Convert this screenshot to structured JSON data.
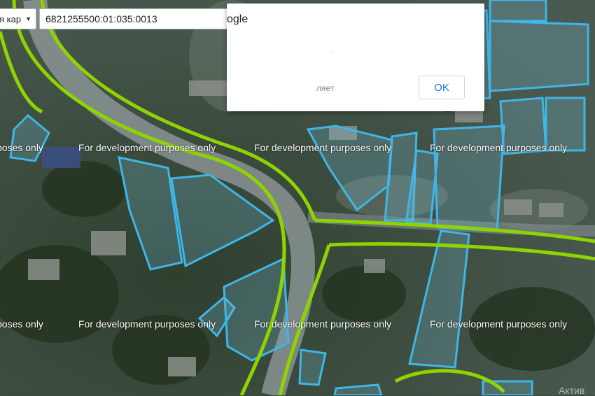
{
  "map_layer_select": {
    "label": "я кар",
    "caret": "▼"
  },
  "search": {
    "value": "6821255500:01:035:0013"
  },
  "dialog": {
    "title": "ogle",
    "message": "·",
    "cancel_label": "ляет",
    "ok_label": "OK"
  },
  "watermark": {
    "text": "For development purposes only",
    "left_fragment": "poses only"
  },
  "activation_text": "Актив",
  "colors": {
    "road_line": "#8fd400",
    "parcel_outline": "#3fb6e8",
    "parcel_fill": "rgba(120,190,220,0.25)"
  }
}
